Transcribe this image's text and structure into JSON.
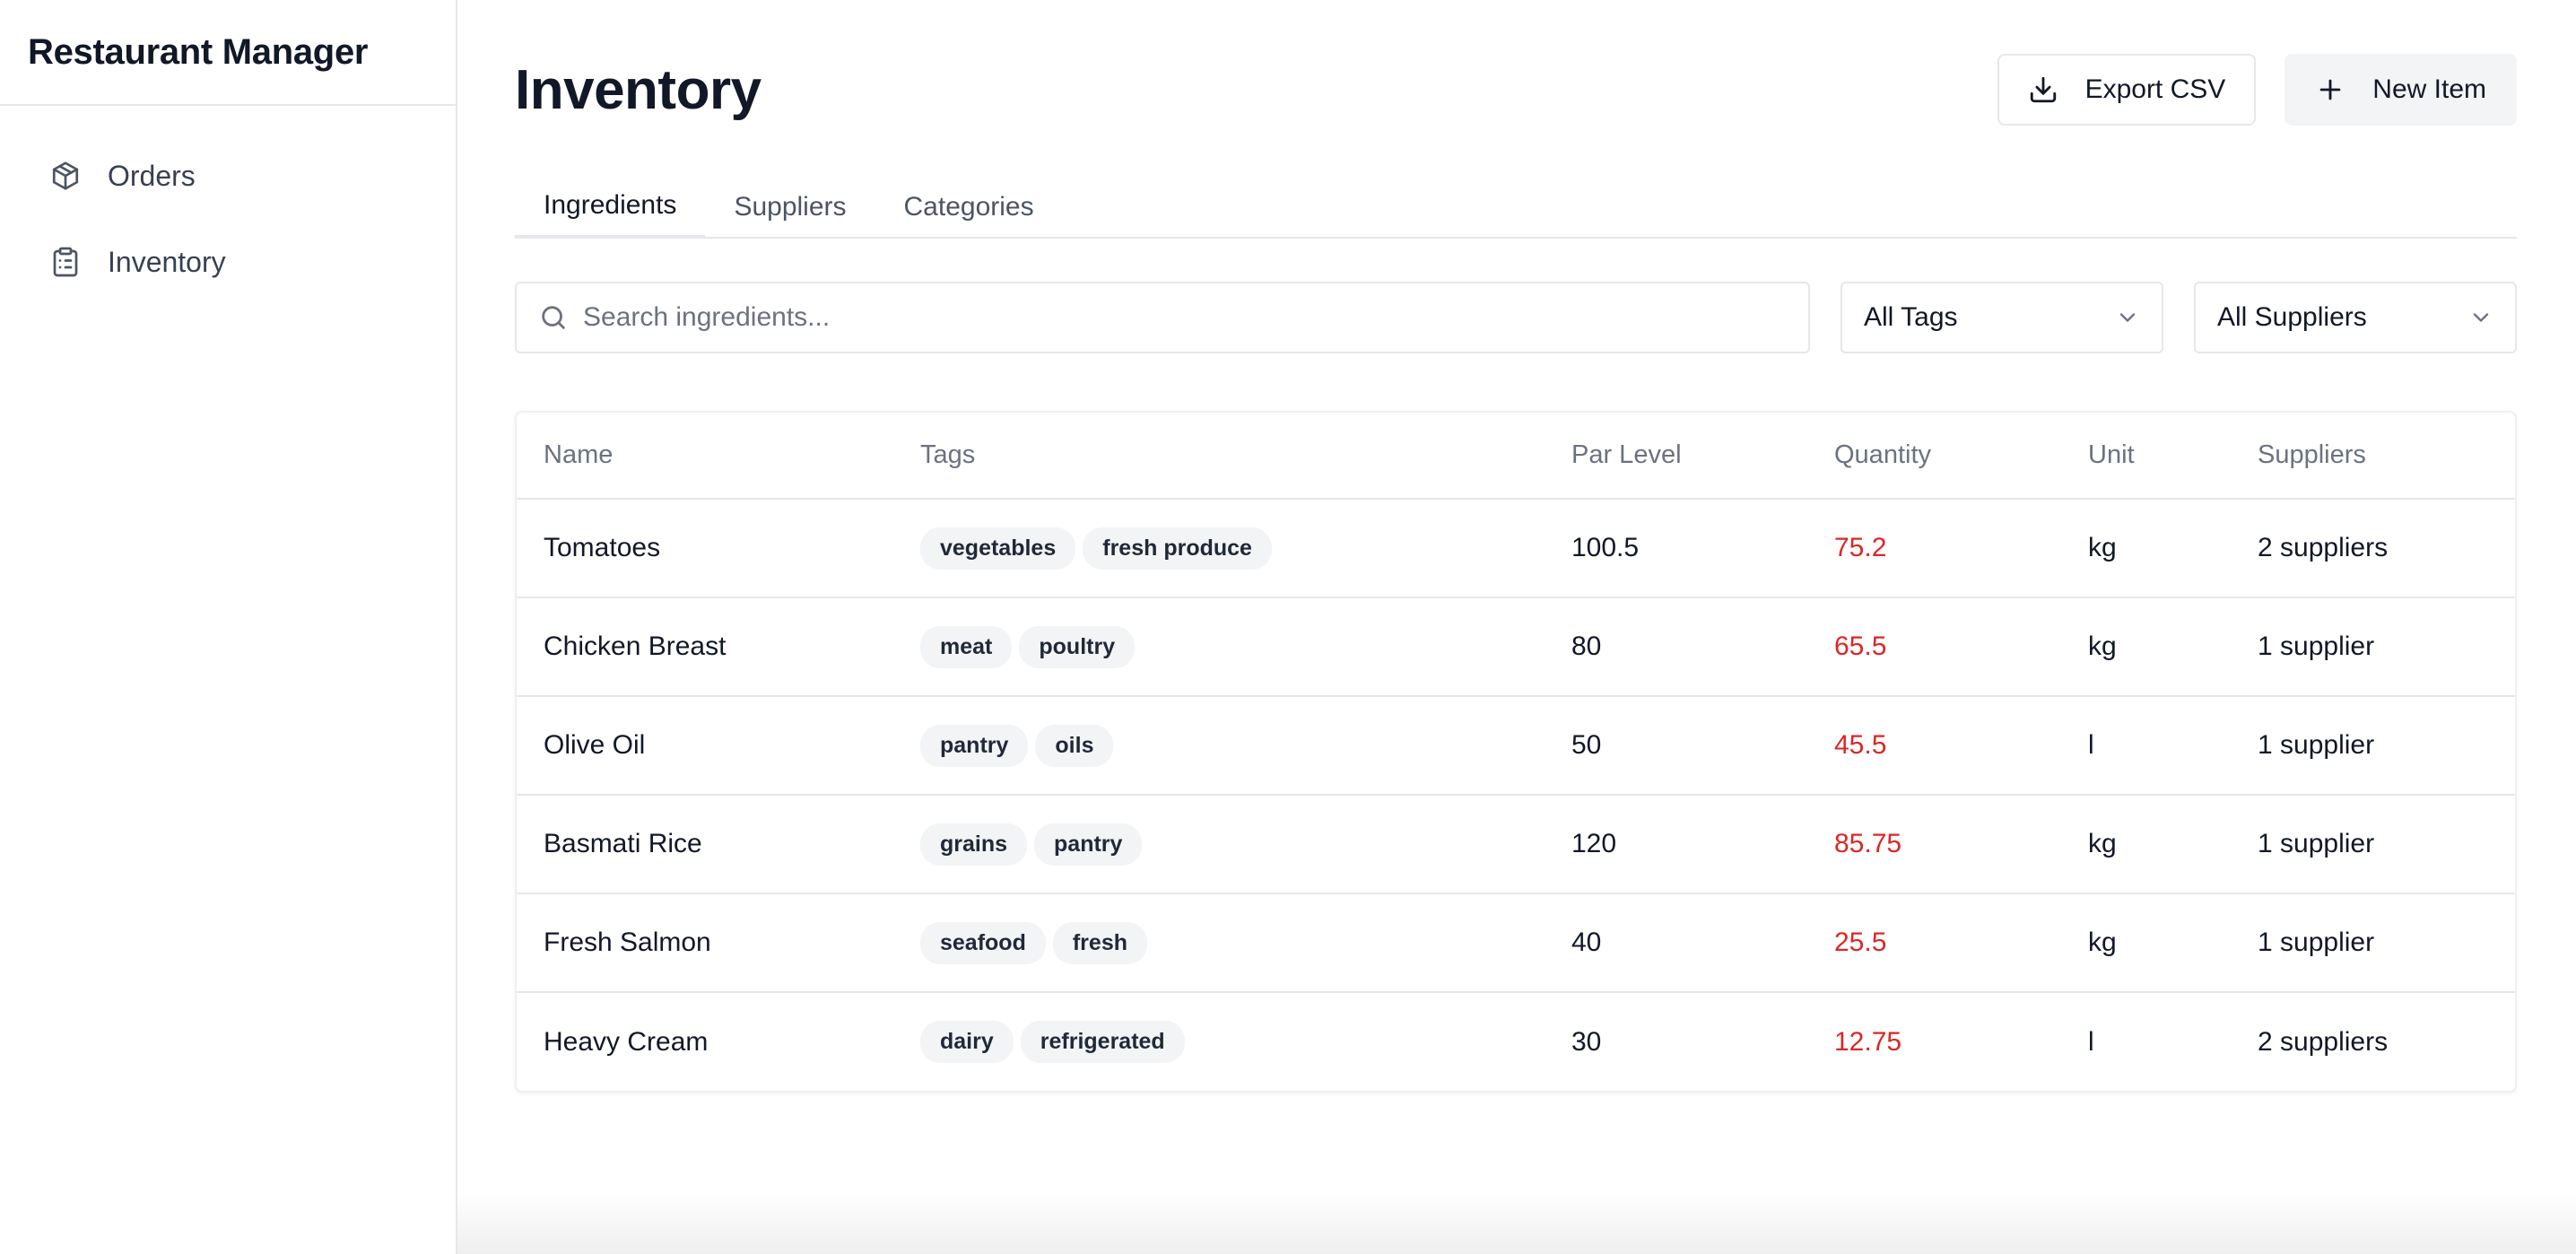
{
  "app": {
    "title": "Restaurant Manager"
  },
  "sidebar": {
    "items": [
      {
        "label": "Orders",
        "icon": "package-icon"
      },
      {
        "label": "Inventory",
        "icon": "clipboard-list-icon"
      }
    ]
  },
  "page": {
    "title": "Inventory"
  },
  "header": {
    "export_label": "Export CSV",
    "new_item_label": "New Item"
  },
  "tabs": [
    {
      "label": "Ingredients",
      "active": true
    },
    {
      "label": "Suppliers",
      "active": false
    },
    {
      "label": "Categories",
      "active": false
    }
  ],
  "filters": {
    "search": {
      "placeholder": "Search ingredients...",
      "value": ""
    },
    "tags_select": "All Tags",
    "suppliers_select": "All Suppliers"
  },
  "table": {
    "columns": [
      "Name",
      "Tags",
      "Par Level",
      "Quantity",
      "Unit",
      "Suppliers"
    ],
    "rows": [
      {
        "name": "Tomatoes",
        "tags": [
          "vegetables",
          "fresh produce"
        ],
        "par": "100.5",
        "qty": "75.2",
        "unit": "kg",
        "suppliers": "2 suppliers"
      },
      {
        "name": "Chicken Breast",
        "tags": [
          "meat",
          "poultry"
        ],
        "par": "80",
        "qty": "65.5",
        "unit": "kg",
        "suppliers": "1 supplier"
      },
      {
        "name": "Olive Oil",
        "tags": [
          "pantry",
          "oils"
        ],
        "par": "50",
        "qty": "45.5",
        "unit": "l",
        "suppliers": "1 supplier"
      },
      {
        "name": "Basmati Rice",
        "tags": [
          "grains",
          "pantry"
        ],
        "par": "120",
        "qty": "85.75",
        "unit": "kg",
        "suppliers": "1 supplier"
      },
      {
        "name": "Fresh Salmon",
        "tags": [
          "seafood",
          "fresh"
        ],
        "par": "40",
        "qty": "25.5",
        "unit": "kg",
        "suppliers": "1 supplier"
      },
      {
        "name": "Heavy Cream",
        "tags": [
          "dairy",
          "refrigerated"
        ],
        "par": "30",
        "qty": "12.75",
        "unit": "l",
        "suppliers": "2 suppliers"
      }
    ]
  },
  "colors": {
    "below_par": "#dc2626",
    "border": "#e5e7eb",
    "tag_bg": "#f3f4f6",
    "text": "#111827",
    "muted_text": "#6b7280"
  }
}
